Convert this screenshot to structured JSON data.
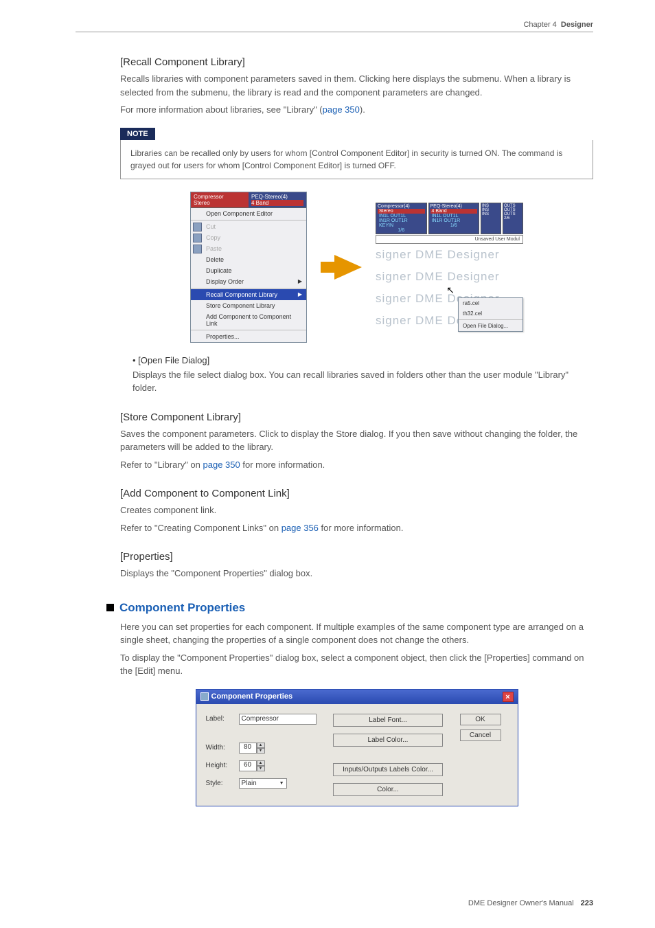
{
  "header": {
    "chapter": "Chapter 4",
    "section": "Designer"
  },
  "s1": {
    "title": "[Recall Component Library]",
    "p1": "Recalls libraries with component parameters saved in them. Clicking here displays the submenu. When a library is selected from the submenu, the library is read and the component parameters are changed.",
    "p2a": "For more information about libraries, see \"Library\" (",
    "p2link": "page 350",
    "p2b": ")."
  },
  "note": {
    "label": "NOTE",
    "text": "Libraries can be recalled only by users for whom [Control Component Editor] in security is turned ON. The command is grayed out for users for whom [Control Component Editor] is turned OFF."
  },
  "ctx": {
    "topL": "Compressor",
    "topLsub": "Stereo",
    "topR": "PEQ-Stereo(4)",
    "topRsub": "4 Band",
    "open": "Open Component Editor",
    "cut": "Cut",
    "copy": "Copy",
    "paste": "Paste",
    "delete": "Delete",
    "duplicate": "Duplicate",
    "displayOrder": "Display Order",
    "recall": "Recall Component Library",
    "store": "Store Component Library",
    "addLink": "Add Component to Component Link",
    "props": "Properties..."
  },
  "rfig": {
    "comp": "Compressor(4)",
    "peq": "PEQ-Stereo(4)",
    "stereo": "Stereo",
    "band": "4 Band",
    "in1l": "IN1L",
    "out1l": "OUT1L",
    "in1r": "IN1R",
    "out1r": "OUT1R",
    "keyin": "KEYIN",
    "ins": "INS",
    "outs": "OUTS",
    "n1": "1/6",
    "n2": "1/6",
    "n3": "2/6",
    "um": "Unsaved User Modul",
    "wm": "signer   DME Designer",
    "sm1": "ra5.cel",
    "sm2": "th32.cel",
    "sm3": "Open File Dialog..."
  },
  "s2": {
    "title": "• [Open File Dialog]",
    "p": "Displays the file select dialog box. You can recall libraries saved in folders other than the user module \"Library\" folder."
  },
  "s3": {
    "title": "[Store Component Library]",
    "p1": "Saves the component parameters. Click to display the Store dialog. If you then save without changing the folder, the parameters will be added to the library.",
    "p2a": "Refer to \"Library\" on ",
    "p2link": "page 350",
    "p2b": " for more information."
  },
  "s4": {
    "title": "[Add Component to Component Link]",
    "p1": "Creates component link.",
    "p2a": "Refer to \"Creating Component Links\" on ",
    "p2link": "page 356",
    "p2b": " for more information."
  },
  "s5": {
    "title": "[Properties]",
    "p": "Displays the \"Component Properties\" dialog box."
  },
  "cp": {
    "title": "Component Properties",
    "p1": "Here you can set properties for each component. If multiple examples of the same component type are arranged on a single sheet, changing the properties of a single component does not change the others.",
    "p2": "To display the \"Component Properties\" dialog box, select a component object, then click the [Properties] command on the [Edit] menu."
  },
  "dialog": {
    "title": "Component Properties",
    "labelLbl": "Label:",
    "labelVal": "Compressor",
    "widthLbl": "Width:",
    "widthVal": "80",
    "heightLbl": "Height:",
    "heightVal": "60",
    "styleLbl": "Style:",
    "styleVal": "Plain",
    "labelFont": "Label Font...",
    "labelColor": "Label Color...",
    "ioColor": "Inputs/Outputs Labels Color...",
    "color": "Color...",
    "ok": "OK",
    "cancel": "Cancel"
  },
  "footer": {
    "manual": "DME Designer Owner's Manual",
    "page": "223"
  }
}
